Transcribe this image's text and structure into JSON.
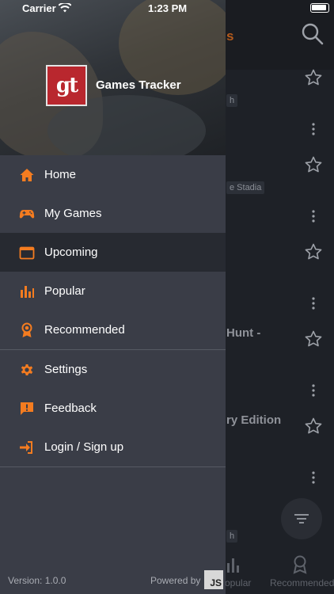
{
  "status_bar": {
    "carrier": "Carrier",
    "time": "1:23 PM"
  },
  "drawer": {
    "logo_text": "gt",
    "app_name": "Games Tracker",
    "menu": [
      {
        "label": "Home",
        "icon": "home-icon",
        "active": false
      },
      {
        "label": "My Games",
        "icon": "gamepad-icon",
        "active": false
      },
      {
        "label": "Upcoming",
        "icon": "calendar-icon",
        "active": true
      },
      {
        "label": "Popular",
        "icon": "bar-chart-icon",
        "active": false
      },
      {
        "label": "Recommended",
        "icon": "award-icon",
        "active": false
      }
    ],
    "secondary_menu": [
      {
        "label": "Settings",
        "icon": "gear-icon"
      },
      {
        "label": "Feedback",
        "icon": "feedback-icon"
      },
      {
        "label": "Login / Sign up",
        "icon": "login-icon"
      }
    ],
    "version": "Version: 1.0.0",
    "powered_by": "Powered by",
    "js_badge": "JS"
  },
  "background": {
    "partial_title": "s",
    "chip_1": "h",
    "chip_2": "e Stadia",
    "text_1": "Hunt -",
    "text_2": "ry Edition",
    "chip_3": "h",
    "tab_popular": "opular",
    "tab_recommended": "Recommended"
  },
  "colors": {
    "accent": "#f47c20",
    "drawer_bg": "#3a3d47",
    "active_bg": "#272a31"
  }
}
